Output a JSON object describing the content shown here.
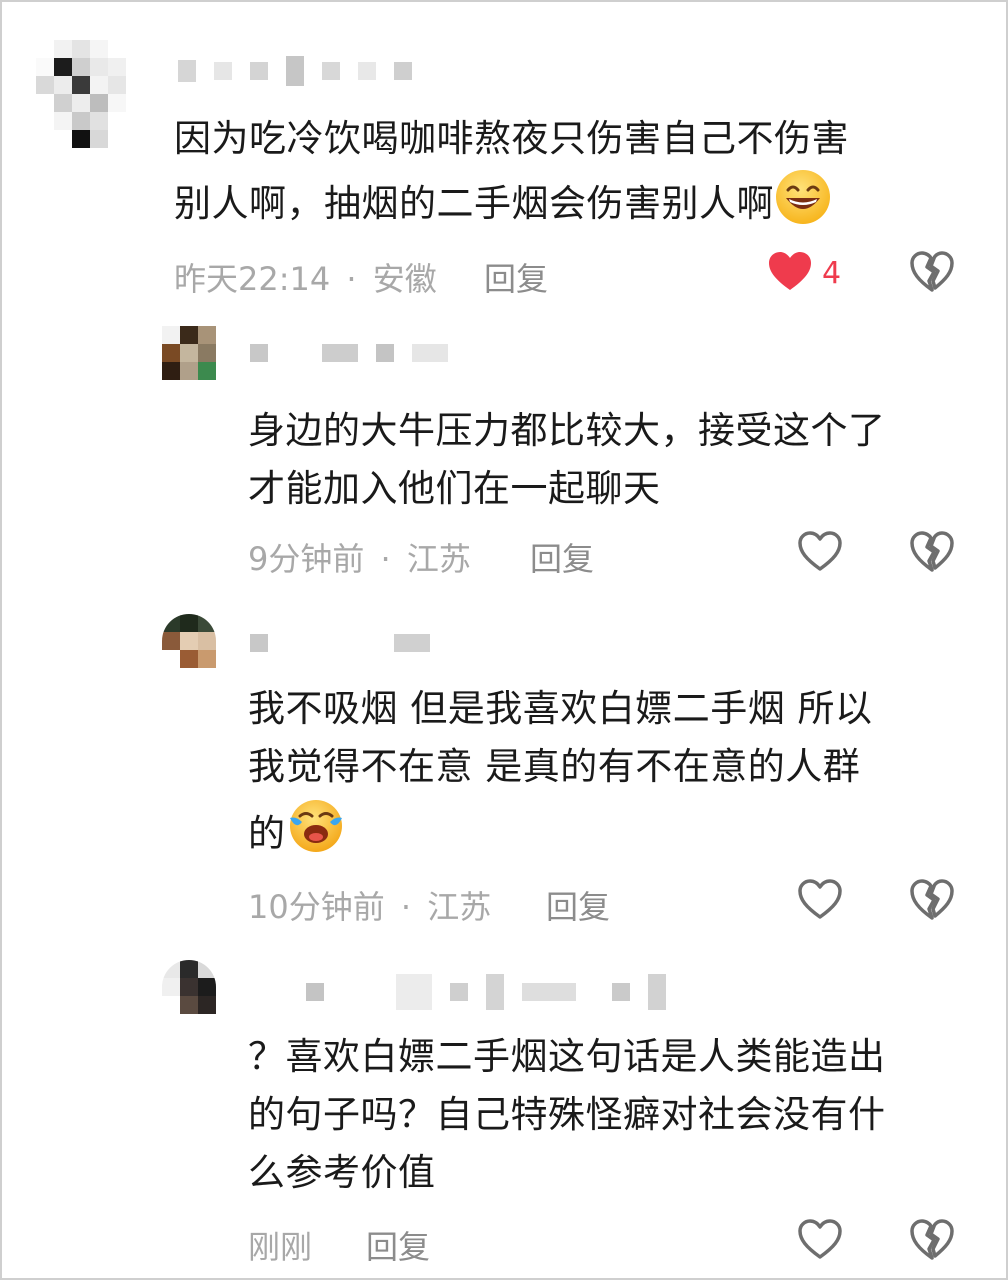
{
  "comments": [
    {
      "text_line1": "因为吃冷饮喝咖啡熬夜只伤害自己不伤害",
      "text_line2": "别人啊，抽烟的二手烟会伤害别人啊",
      "emoji": "grinning-squint-emoji",
      "time": "昨天22:14",
      "separator": "·",
      "location": "安徽",
      "reply_label": "回复",
      "like_count": "4",
      "liked": true
    },
    {
      "text_line1": "身边的大牛压力都比较大，接受这个了",
      "text_line2": "才能加入他们在一起聊天",
      "time": "9分钟前",
      "separator": "·",
      "location": "江苏",
      "reply_label": "回复",
      "liked": false
    },
    {
      "text_line1": "我不吸烟 但是我喜欢白嫖二手烟 所以",
      "text_line2": "我觉得不在意 是真的有不在意的人群",
      "text_line3": "的",
      "emoji": "crying-laughing-emoji",
      "time": "10分钟前",
      "separator": "·",
      "location": "江苏",
      "reply_label": "回复",
      "liked": false
    },
    {
      "text_line1": "？喜欢白嫖二手烟这句话是人类能造出",
      "text_line2": "的句子吗？自己特殊怪癖对社会没有什",
      "text_line3": "么参考价值",
      "time": "刚刚",
      "reply_label": "回复",
      "liked": false
    }
  ],
  "colors": {
    "like_red": "#ef3b4d",
    "meta_gray": "#a8a8a8",
    "icon_gray": "#6e6e6e"
  }
}
